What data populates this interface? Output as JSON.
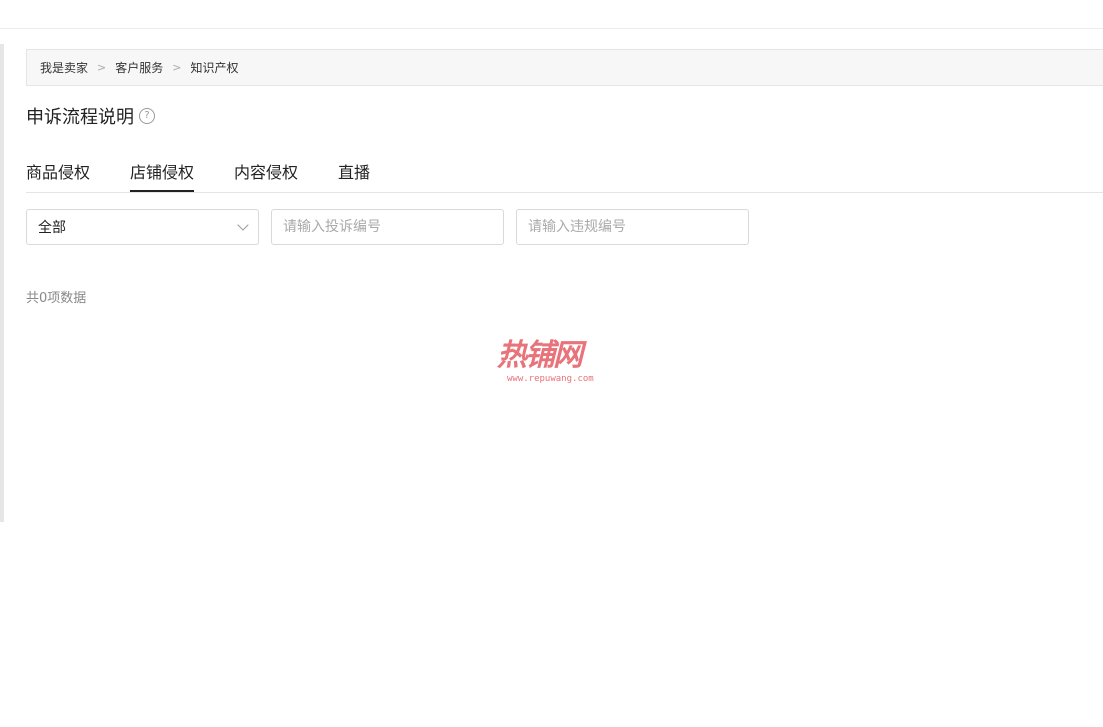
{
  "breadcrumb": {
    "items": [
      "我是卖家",
      "客户服务",
      "知识产权"
    ],
    "separator": ">"
  },
  "page_title": "申诉流程说明",
  "help_icon_glyph": "?",
  "tabs": [
    {
      "label": "商品侵权",
      "active": false
    },
    {
      "label": "店铺侵权",
      "active": true
    },
    {
      "label": "内容侵权",
      "active": false
    },
    {
      "label": "直播",
      "active": false
    }
  ],
  "filters": {
    "select_value": "全部",
    "complaint_placeholder": "请输入投诉编号",
    "violation_placeholder": "请输入违规编号"
  },
  "result_count": "共0项数据",
  "watermark": {
    "brand": "热铺网",
    "url": "www.repuwang.com"
  }
}
